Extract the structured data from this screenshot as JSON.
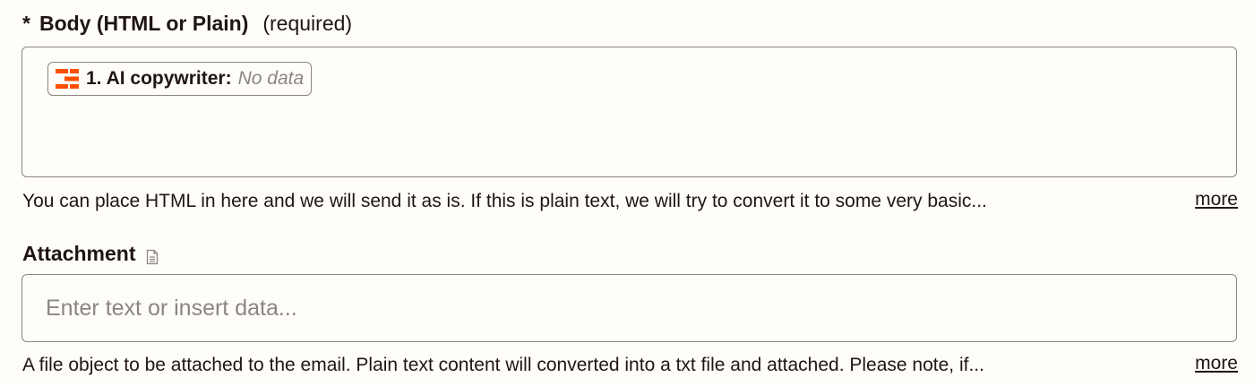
{
  "body_field": {
    "star": "*",
    "label": "Body (HTML or Plain)",
    "required_text": "(required)",
    "pill": {
      "icon": "zapier-ai-step-icon",
      "step_label": "1. AI copywriter:",
      "value": "No data"
    },
    "help_text": "You can place HTML in here and we will send it as is. If this is plain text, we will try to convert it to some very basic...",
    "more_label": "more"
  },
  "attachment_field": {
    "label": "Attachment",
    "icon": "document-icon",
    "placeholder": "Enter text or insert data...",
    "help_text": "A file object to be attached to the email. Plain text content will converted into a txt file and attached. Please note, if...",
    "more_label": "more"
  },
  "colors": {
    "background": "#fffdf9",
    "border": "#8a8680",
    "text": "#201515",
    "muted": "#8a8680",
    "accent": "#ff4f00"
  }
}
